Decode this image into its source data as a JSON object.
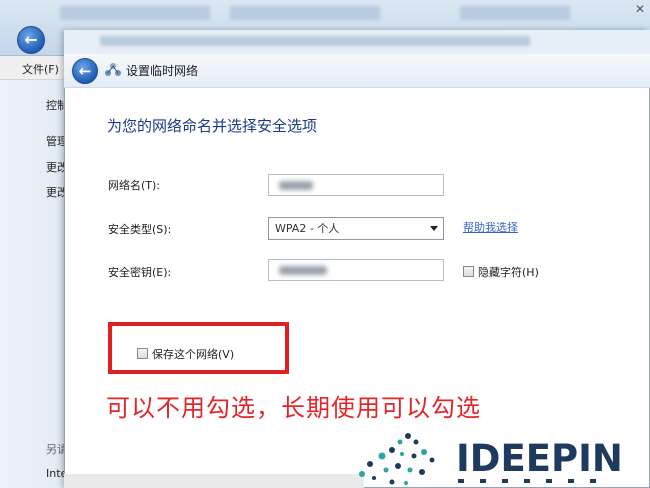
{
  "background_window": {
    "menu_file": "文件(F)",
    "sidebar_items": [
      "控制",
      "管理",
      "更改",
      "更改"
    ],
    "sidebar_bottom": [
      "另请",
      "Inte"
    ]
  },
  "dialog": {
    "title": "设置临时网络",
    "heading": "为您的网络命名并选择安全选项",
    "network_name_label": "网络名(T):",
    "security_type_label": "安全类型(S):",
    "security_type_value": "WPA2 - 个人",
    "help_link": "帮助我选择",
    "security_key_label": "安全密钥(E):",
    "hide_chars_label": "隐藏字符(H)",
    "save_network_label": "保存这个网络(V)"
  },
  "annotation": "可以不用勾选，长期使用可以勾选",
  "watermark": {
    "brand": "IDEEPIN"
  },
  "colors": {
    "annotation": "#e4262b",
    "highlight_box": "#e02020",
    "heading": "#1c3a8a",
    "link": "#3366cc"
  }
}
